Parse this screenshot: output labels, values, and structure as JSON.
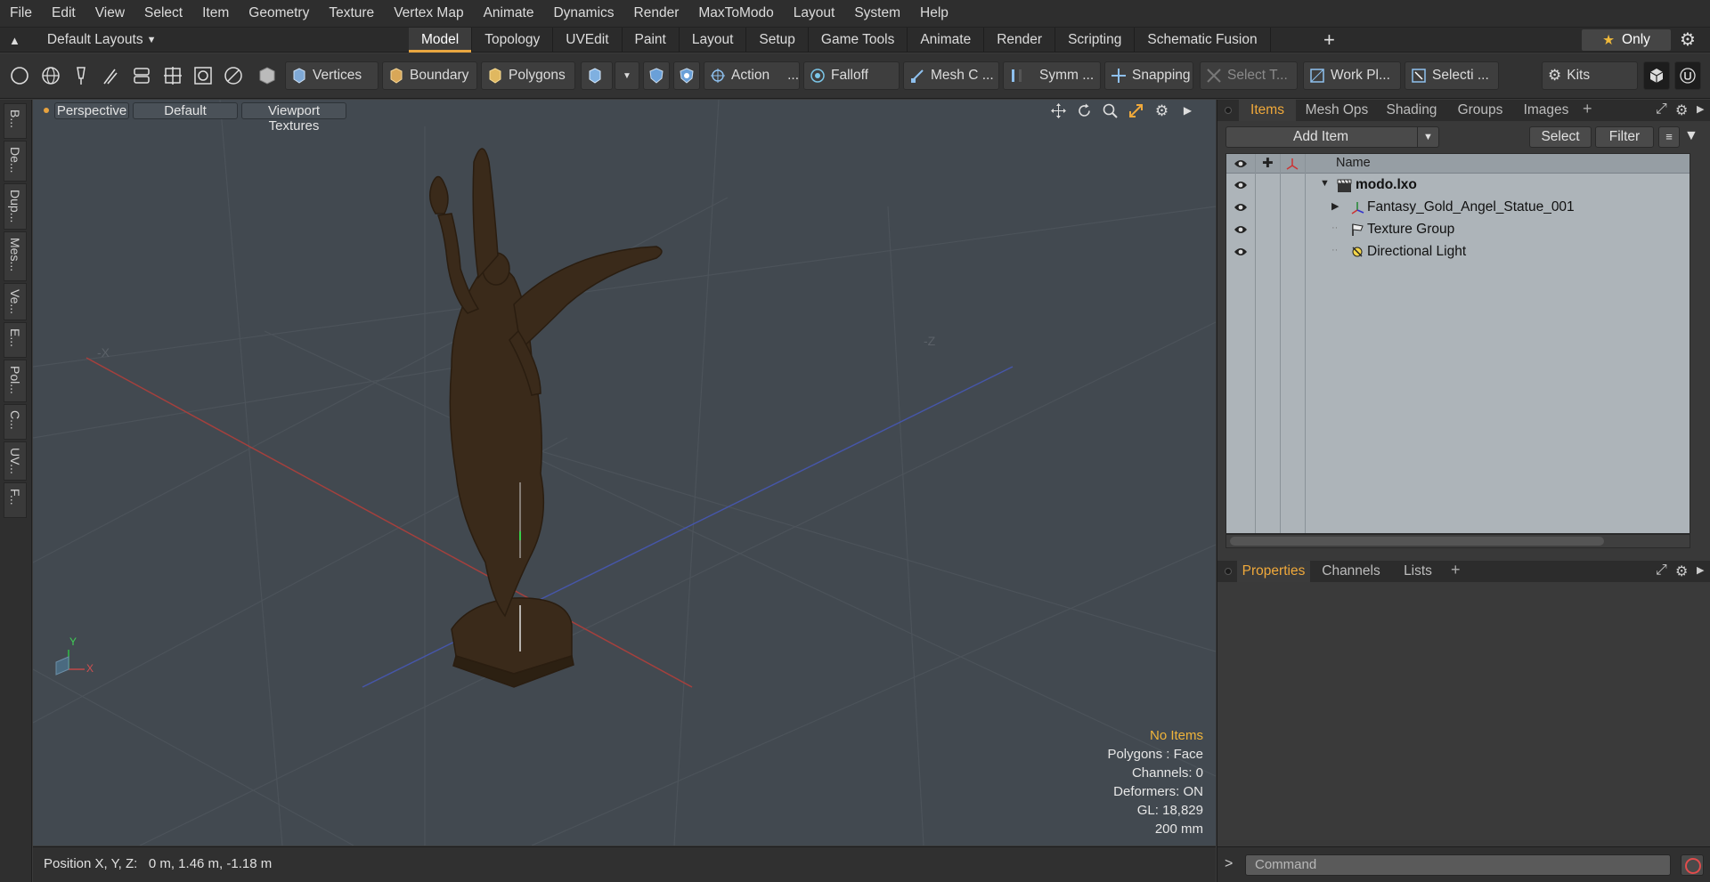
{
  "menu": [
    "File",
    "Edit",
    "View",
    "Select",
    "Item",
    "Geometry",
    "Texture",
    "Vertex Map",
    "Animate",
    "Dynamics",
    "Render",
    "MaxToModo",
    "Layout",
    "System",
    "Help"
  ],
  "layouts": {
    "label": "Default Layouts"
  },
  "tabs": [
    "Model",
    "Topology",
    "UVEdit",
    "Paint",
    "Layout",
    "Setup",
    "Game Tools",
    "Animate",
    "Render",
    "Scripting",
    "Schematic Fusion"
  ],
  "active_tab": "Model",
  "only_label": "Only",
  "toolbar": {
    "vertices": "Vertices",
    "boundary": "Boundary",
    "polygons": "Polygons",
    "action": "Action",
    "action_more": "...",
    "falloff": "Falloff",
    "meshc": "Mesh C ...",
    "symm": "Symm ...",
    "snapping": "Snapping",
    "select_t": "Select T...",
    "workpl": "Work Pl...",
    "selecti": "Selecti ...",
    "kits": "Kits"
  },
  "left_strip": [
    "B...",
    "De...",
    "Dup...",
    "Mes...",
    "Ve...",
    "E...",
    "Pol...",
    "C...",
    "UV...",
    "F..."
  ],
  "viewport": {
    "view": "Perspective",
    "shading": "Default",
    "textures": "Viewport Textures",
    "axis_neg_x": "-X",
    "axis_neg_z": "-Z",
    "gizmo_y": "Y",
    "gizmo_x": "X",
    "stats": {
      "no_items": "No Items",
      "polygons": "Polygons : Face",
      "channels": "Channels: 0",
      "deformers": "Deformers: ON",
      "gl": "GL: 18,829",
      "size": "200 mm"
    }
  },
  "status": {
    "position": "Position X, Y, Z:   0 m, 1.46 m, -1.18 m"
  },
  "items_panel": {
    "tabs": [
      "Items",
      "Mesh Ops",
      "Shading",
      "Groups",
      "Images"
    ],
    "add_item": "Add Item",
    "select": "Select",
    "filter": "Filter",
    "col_name": "Name",
    "rows": [
      {
        "label": "modo.lxo",
        "bold": true
      },
      {
        "label": "Fantasy_Gold_Angel_Statue_001"
      },
      {
        "label": "Texture Group"
      },
      {
        "label": "Directional Light"
      }
    ]
  },
  "properties_panel": {
    "tabs": [
      "Properties",
      "Channels",
      "Lists"
    ]
  },
  "command": {
    "placeholder": "Command"
  },
  "colors": {
    "accent": "#f0a93b",
    "viewport_bg": "#424950",
    "statue": "#3a2a1a"
  }
}
